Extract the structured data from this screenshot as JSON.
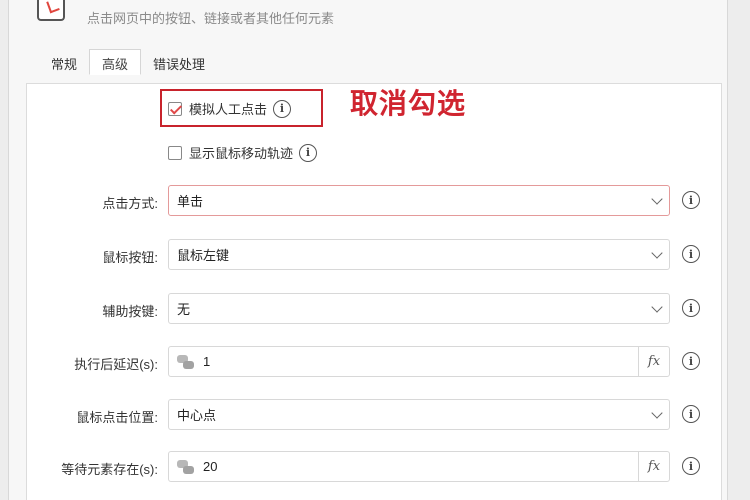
{
  "header": {
    "description": "点击网页中的按钮、链接或者其他任何元素",
    "icon": "click-element-icon",
    "help_icon": "help-icon"
  },
  "tabs": [
    {
      "label": "常规",
      "active": false
    },
    {
      "label": "高级",
      "active": true
    },
    {
      "label": "错误处理",
      "active": false
    }
  ],
  "checkboxes": {
    "simulate_click": {
      "label": "模拟人工点击",
      "checked": true
    },
    "show_trail": {
      "label": "显示鼠标移动轨迹",
      "checked": false
    }
  },
  "annotation": {
    "text": "取消勾选",
    "color": "#d02530"
  },
  "fields": {
    "click_mode": {
      "label": "点击方式:",
      "value": "单击"
    },
    "mouse_button": {
      "label": "鼠标按钮:",
      "value": "鼠标左键"
    },
    "modifier_key": {
      "label": "辅助按键:",
      "value": "无"
    },
    "delay_after": {
      "label": "执行后延迟(s):",
      "value": "1",
      "fx": "fx"
    },
    "click_position": {
      "label": "鼠标点击位置:",
      "value": "中心点"
    },
    "wait_element": {
      "label": "等待元素存在(s):",
      "value": "20",
      "fx": "fx"
    }
  },
  "info_glyph": "i",
  "colors": {
    "accent_red": "#c8232c",
    "help_blue": "#3d8ee6"
  }
}
